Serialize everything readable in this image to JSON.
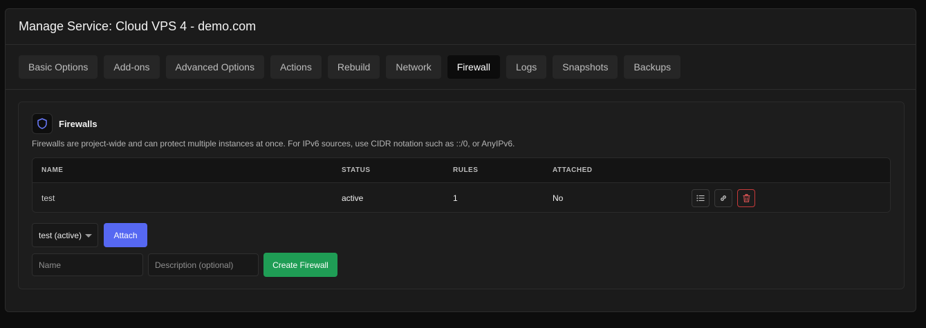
{
  "header": {
    "title": "Manage Service: Cloud VPS 4 - demo.com"
  },
  "tabs": [
    {
      "label": "Basic Options",
      "active": false
    },
    {
      "label": "Add-ons",
      "active": false
    },
    {
      "label": "Advanced Options",
      "active": false
    },
    {
      "label": "Actions",
      "active": false
    },
    {
      "label": "Rebuild",
      "active": false
    },
    {
      "label": "Network",
      "active": false
    },
    {
      "label": "Firewall",
      "active": true
    },
    {
      "label": "Logs",
      "active": false
    },
    {
      "label": "Snapshots",
      "active": false
    },
    {
      "label": "Backups",
      "active": false
    }
  ],
  "firewalls": {
    "title": "Firewalls",
    "icon": "shield-icon",
    "description": "Firewalls are project-wide and can protect multiple instances at once. For IPv6 sources, use CIDR notation such as ::/0, or AnyIPv6.",
    "columns": {
      "name": "NAME",
      "status": "STATUS",
      "rules": "RULES",
      "attached": "ATTACHED"
    },
    "rows": [
      {
        "name": "test",
        "status": "active",
        "rules": "1",
        "attached": "No"
      }
    ],
    "row_actions": [
      "list-icon",
      "link-icon",
      "trash-icon"
    ]
  },
  "attach": {
    "selected": "test (active)",
    "button_label": "Attach"
  },
  "create": {
    "name_placeholder": "Name",
    "description_placeholder": "Description (optional)",
    "button_label": "Create Firewall"
  },
  "colors": {
    "accent_blue": "#5668f2",
    "success_green": "#1f9d55",
    "danger_red": "#c73a3a",
    "shield_blue": "#6b7cff"
  }
}
